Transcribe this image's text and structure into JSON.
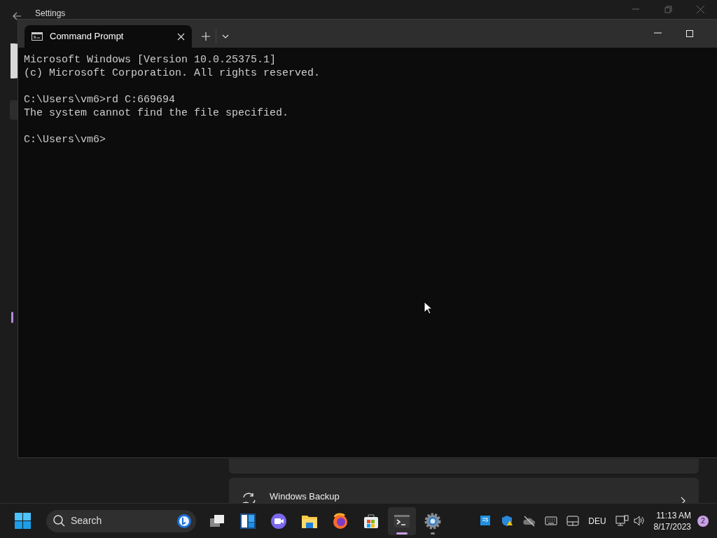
{
  "settings_window": {
    "title": "Settings",
    "cards": [
      {
        "kind": "partial"
      },
      {
        "kind": "link",
        "text": "Windows Backup"
      }
    ]
  },
  "terminal": {
    "tabs": [
      {
        "label": "Command Prompt",
        "selected": true
      }
    ],
    "blocks": [
      [
        "Microsoft Windows [Version 10.0.25375.1]",
        "(c) Microsoft Corporation. All rights reserved."
      ],
      [
        "C:\\Users\\vm6>rd C:669694",
        "The system cannot find the file specified."
      ],
      [
        "C:\\Users\\vm6>"
      ]
    ]
  },
  "taskbar": {
    "search": {
      "placeholder": "Search"
    },
    "apps": [
      {
        "kind": "taskview",
        "selected": false,
        "running": false
      },
      {
        "kind": "widgets",
        "selected": false,
        "running": false
      },
      {
        "kind": "chat",
        "selected": false,
        "running": false
      },
      {
        "kind": "folder",
        "selected": false,
        "running": false
      },
      {
        "kind": "browser",
        "selected": false,
        "running": false
      },
      {
        "kind": "store",
        "selected": false,
        "running": false
      },
      {
        "kind": "terminal",
        "selected": true,
        "running": true
      },
      {
        "kind": "settings",
        "selected": false,
        "running": true
      }
    ],
    "tray": [
      {
        "kind": "remote"
      },
      {
        "kind": "shield"
      },
      {
        "kind": "cloud"
      },
      {
        "kind": "keyboard"
      },
      {
        "kind": "touchpad"
      }
    ],
    "language": "DEU",
    "time": "11:13 AM",
    "date": "8/17/2023",
    "notifications": "2"
  }
}
